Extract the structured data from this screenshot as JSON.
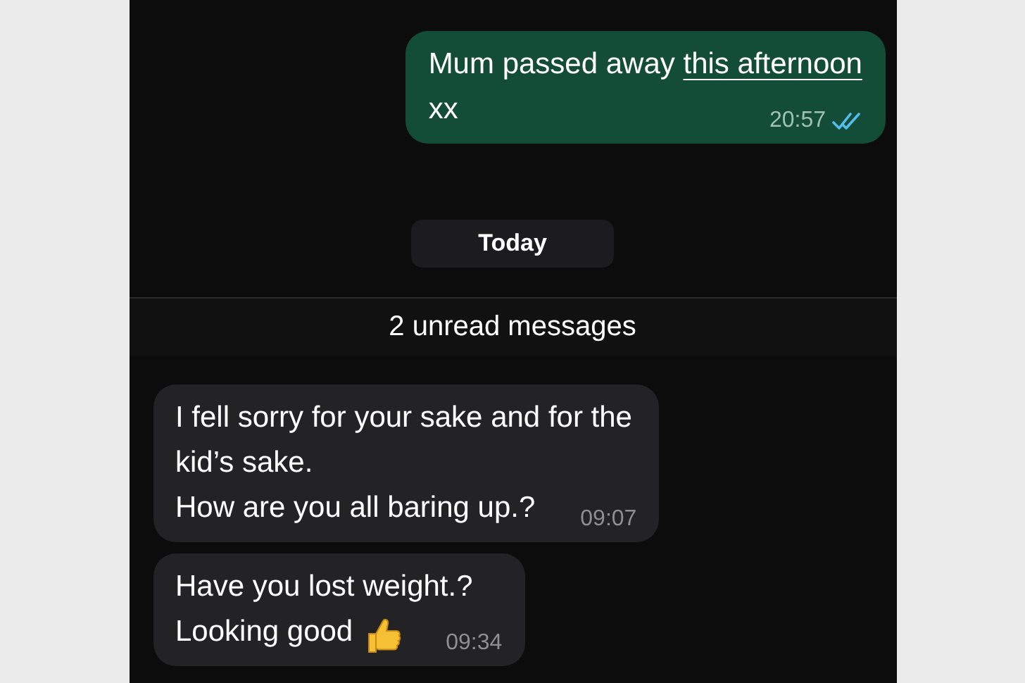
{
  "messages_before": [
    {
      "kind": "outgoing",
      "lines": [
        [
          {
            "text": "Mum passed away "
          },
          {
            "text": "this afternoon",
            "underlined": true
          }
        ],
        [
          {
            "text": "xx"
          }
        ]
      ],
      "time": "20:57",
      "read": true
    }
  ],
  "date_chip": "Today",
  "unread_banner": "2 unread messages",
  "messages_after": [
    {
      "kind": "incoming",
      "lines": [
        [
          {
            "text": "I fell sorry for your sake and for the"
          }
        ],
        [
          {
            "text": "kid’s sake."
          }
        ],
        [
          {
            "text": "How are you all baring up.?"
          }
        ]
      ],
      "time": "09:07"
    },
    {
      "kind": "incoming",
      "lines": [
        [
          {
            "text": "Have you lost weight.?"
          }
        ],
        [
          {
            "text": "Looking good"
          }
        ]
      ],
      "thumbs_up": true,
      "time": "09:34"
    }
  ]
}
